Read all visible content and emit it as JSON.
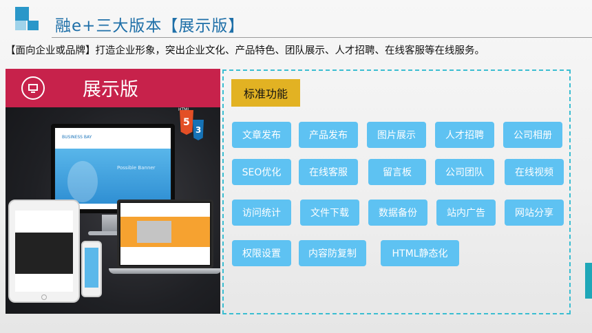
{
  "slide": {
    "title": "融e+三大版本【展示版】",
    "subtitle": "【面向企业或品牌】打造企业形象，突出企业文化、产品特色、团队展示、人才招聘、在线客服等在线服务。"
  },
  "showcase": {
    "title": "展示版",
    "html5_tag": "HTML",
    "html5_number": "5",
    "css3_number": "3",
    "monitor_brand": "BUSINESS BAY",
    "monitor_banner": "Possible Banner"
  },
  "features": {
    "heading": "标准功能",
    "button_color": "#5ec2f2",
    "heading_color": "#e2b223",
    "items": [
      "文章发布",
      "产品发布",
      "图片展示",
      "人才招聘",
      "公司相册",
      "SEO优化",
      "在线客服",
      "留言板",
      "公司团队",
      "在线视频",
      "访问统计",
      "文件下载",
      "数据备份",
      "站内广告",
      "网站分享",
      "权限设置",
      "内容防复制",
      "HTML静态化"
    ]
  }
}
